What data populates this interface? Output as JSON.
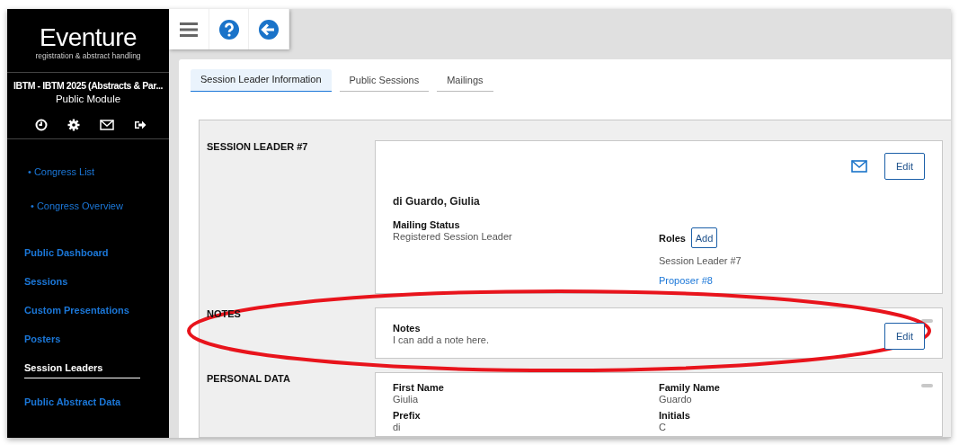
{
  "sidebar": {
    "logo": "Eventure",
    "tagline": "registration & abstract handling",
    "congress": "IBTM - IBTM 2025 (Abstracts & Par...",
    "module": "Public Module",
    "nav": [
      {
        "label": "• Congress List",
        "kind": "sub",
        "selected": false
      },
      {
        "label": "• Congress Overview",
        "kind": "sub",
        "selected": false
      },
      {
        "label": "Public Dashboard",
        "kind": "main",
        "selected": false
      },
      {
        "label": "Sessions",
        "kind": "main",
        "selected": false
      },
      {
        "label": "Custom Presentations",
        "kind": "main",
        "selected": false
      },
      {
        "label": "Posters",
        "kind": "main",
        "selected": false
      },
      {
        "label": "Session Leaders",
        "kind": "main",
        "selected": true
      },
      {
        "label": "Public Abstract Data",
        "kind": "main",
        "selected": false
      }
    ]
  },
  "tabs": [
    {
      "label": "Session Leader Information",
      "selected": true
    },
    {
      "label": "Public Sessions",
      "selected": false
    },
    {
      "label": "Mailings",
      "selected": false
    }
  ],
  "leader": {
    "heading": "SESSION LEADER #7",
    "name": "di Guardo, Giulia",
    "edit": "Edit",
    "mailing_status": {
      "label": "Mailing Status",
      "value": "Registered Session Leader"
    },
    "roles": {
      "label": "Roles",
      "add": "Add",
      "items": [
        {
          "text": "Session Leader #7",
          "kind": "text"
        },
        {
          "text": "Proposer #8",
          "kind": "link"
        }
      ]
    }
  },
  "notes": {
    "heading": "NOTES",
    "label": "Notes",
    "value": "I can add a note here.",
    "edit": "Edit"
  },
  "personal_data": {
    "heading": "PERSONAL DATA",
    "fields": [
      {
        "label": "First Name",
        "value": "Giulia"
      },
      {
        "label": "Family Name",
        "value": "Guardo"
      },
      {
        "label": "Prefix",
        "value": "di"
      },
      {
        "label": "Initials",
        "value": "C"
      }
    ]
  }
}
